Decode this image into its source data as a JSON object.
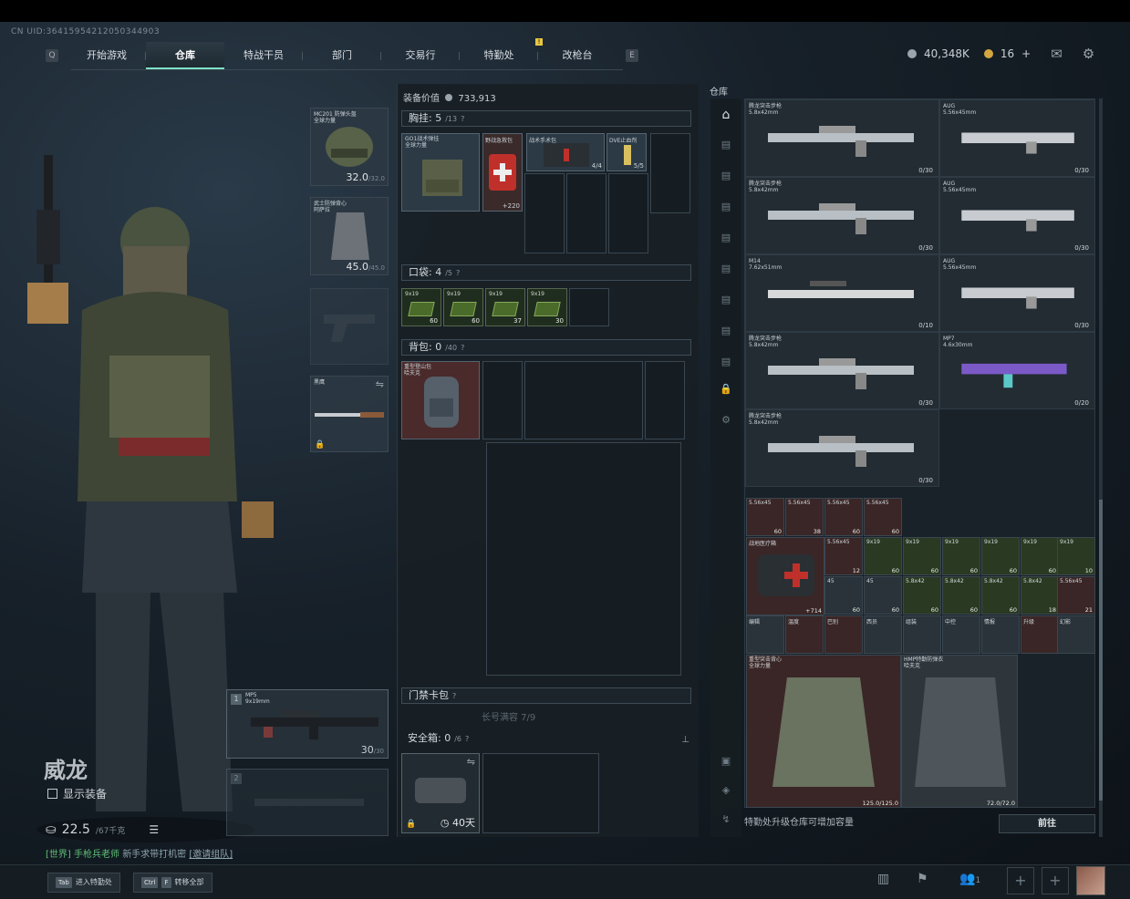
{
  "uid": "CN UID:36415954212050344903",
  "nav": {
    "left_key": "Q",
    "right_key": "E",
    "tabs": [
      "开始游戏",
      "仓库",
      "特战干员",
      "部门",
      "交易行",
      "特勤处",
      "改枪台"
    ],
    "active_tab": "仓库",
    "notification_badge": "!"
  },
  "currency": {
    "balance": "40,348K",
    "premium": "16",
    "premium_add": "+"
  },
  "character": {
    "name": "威龙",
    "show_gear_label": "显示装备",
    "weight": "22.5",
    "weight_max": "/67千克"
  },
  "chat": {
    "channel": "[世界]",
    "sender": "手枪兵老师",
    "message": "新手求带打机密",
    "link": "[邀请组队]"
  },
  "slots": {
    "helmet": {
      "name": "MC201 防弹头盔",
      "sub": "全球力量",
      "durability": "32.0",
      "max": "/32.0"
    },
    "armor": {
      "name": "武士防弹背心",
      "sub": "阿萨拉",
      "durability": "45.0",
      "max": "/45.0"
    },
    "melee": {
      "name": "黑鹰"
    },
    "primary": {
      "index": "1",
      "name": "MP5",
      "caliber": "9x19mm",
      "ammo": "30",
      "ammo_max": "/30"
    },
    "secondary": {
      "index": "2"
    }
  },
  "loadout": {
    "value_label": "装备价值",
    "value": "733,913",
    "rig": {
      "label": "胸挂:",
      "count": "5",
      "max": "/13"
    },
    "rig_item": {
      "name": "GO1战术弹挂",
      "sub": "全球力量"
    },
    "rig_contents": [
      {
        "name": "野战急救包",
        "count": "+220"
      },
      {
        "name": "战术手术包",
        "count": "4/4"
      },
      {
        "name": "DVE止血剂",
        "count": "5/5"
      }
    ],
    "pockets": {
      "label": "口袋:",
      "count": "4",
      "max": "/5"
    },
    "pocket_ammo": [
      {
        "name": "9x19",
        "count": "60"
      },
      {
        "name": "9x19",
        "count": "60"
      },
      {
        "name": "9x19",
        "count": "37"
      },
      {
        "name": "9x19",
        "count": "30"
      }
    ],
    "backpack": {
      "label": "背包:",
      "count": "0",
      "max": "/40"
    },
    "backpack_item": {
      "name": "重型登山包",
      "sub": "哈夫克"
    },
    "keycard": {
      "label": "门禁卡包"
    },
    "long_storage": "长号满容 7/9",
    "safe": {
      "label": "安全箱:",
      "count": "0",
      "max": "/6",
      "days": "40天"
    }
  },
  "warehouse": {
    "title": "仓库",
    "guns": [
      {
        "name": "腾龙突击步枪",
        "caliber": "5.8x42mm",
        "ammo": "0/30"
      },
      {
        "name": "AUG",
        "caliber": "5.56x45mm",
        "ammo": "0/30"
      },
      {
        "name": "腾龙突击步枪",
        "caliber": "5.8x42mm",
        "ammo": "0/30"
      },
      {
        "name": "AUG",
        "caliber": "5.56x45mm",
        "ammo": "0/30"
      },
      {
        "name": "M14",
        "caliber": "7.62x51mm",
        "ammo": "0/10"
      },
      {
        "name": "AUG",
        "caliber": "5.56x45mm",
        "ammo": "0/30"
      },
      {
        "name": "腾龙突击步枪",
        "caliber": "5.8x42mm",
        "ammo": "0/30"
      },
      {
        "name": "MP7",
        "caliber": "4.6x30mm",
        "ammo": "0/20"
      },
      {
        "name": "腾龙突击步枪",
        "caliber": "5.8x42mm",
        "ammo": "0/30"
      }
    ],
    "ammo_row1": [
      {
        "name": "5.56x45",
        "count": "60"
      },
      {
        "name": "5.56x45",
        "count": "38"
      },
      {
        "name": "5.56x45",
        "count": "60"
      },
      {
        "name": "5.56x45",
        "count": "60"
      }
    ],
    "medkit": {
      "name": "战地医疗箱",
      "count": "+714"
    },
    "ammo_row2": [
      {
        "name": "5.56x45",
        "count": "12"
      },
      {
        "name": "9x19",
        "count": "60"
      },
      {
        "name": "9x19",
        "count": "60"
      },
      {
        "name": "9x19",
        "count": "60"
      },
      {
        "name": "9x19",
        "count": "60"
      },
      {
        "name": "9x19",
        "count": "60"
      },
      {
        "name": "9x19",
        "count": "10"
      }
    ],
    "ammo_row3": [
      {
        "name": "45",
        "count": "60"
      },
      {
        "name": "45",
        "count": "60"
      },
      {
        "name": "5.8x42",
        "count": "60"
      },
      {
        "name": "5.8x42",
        "count": "60"
      },
      {
        "name": "5.8x42",
        "count": "60"
      },
      {
        "name": "5.8x42",
        "count": "18"
      },
      {
        "name": "5.56x45",
        "count": "21"
      }
    ],
    "cards": [
      {
        "name": "编辑"
      },
      {
        "name": "温度"
      },
      {
        "name": "巴别"
      },
      {
        "name": "西员"
      },
      {
        "name": "组装"
      },
      {
        "name": "中控"
      },
      {
        "name": "情报"
      },
      {
        "name": "升级"
      },
      {
        "name": "幻影"
      }
    ],
    "armor1": {
      "name": "重型突击背心",
      "sub": "全球力量",
      "durability": "125.0/125.0"
    },
    "armor2": {
      "name": "HMP特勤防弹衣",
      "sub": "哈夫克",
      "durability": "72.0/72.0"
    },
    "footer_text": "特勤处升级仓库可增加容量",
    "go_button": "前往"
  },
  "bottom": {
    "k1": "Tab",
    "k1_label": "进入特勤处",
    "k2a": "Ctrl",
    "k2b": "F",
    "k2_label": "转移全部",
    "friends": "1"
  }
}
